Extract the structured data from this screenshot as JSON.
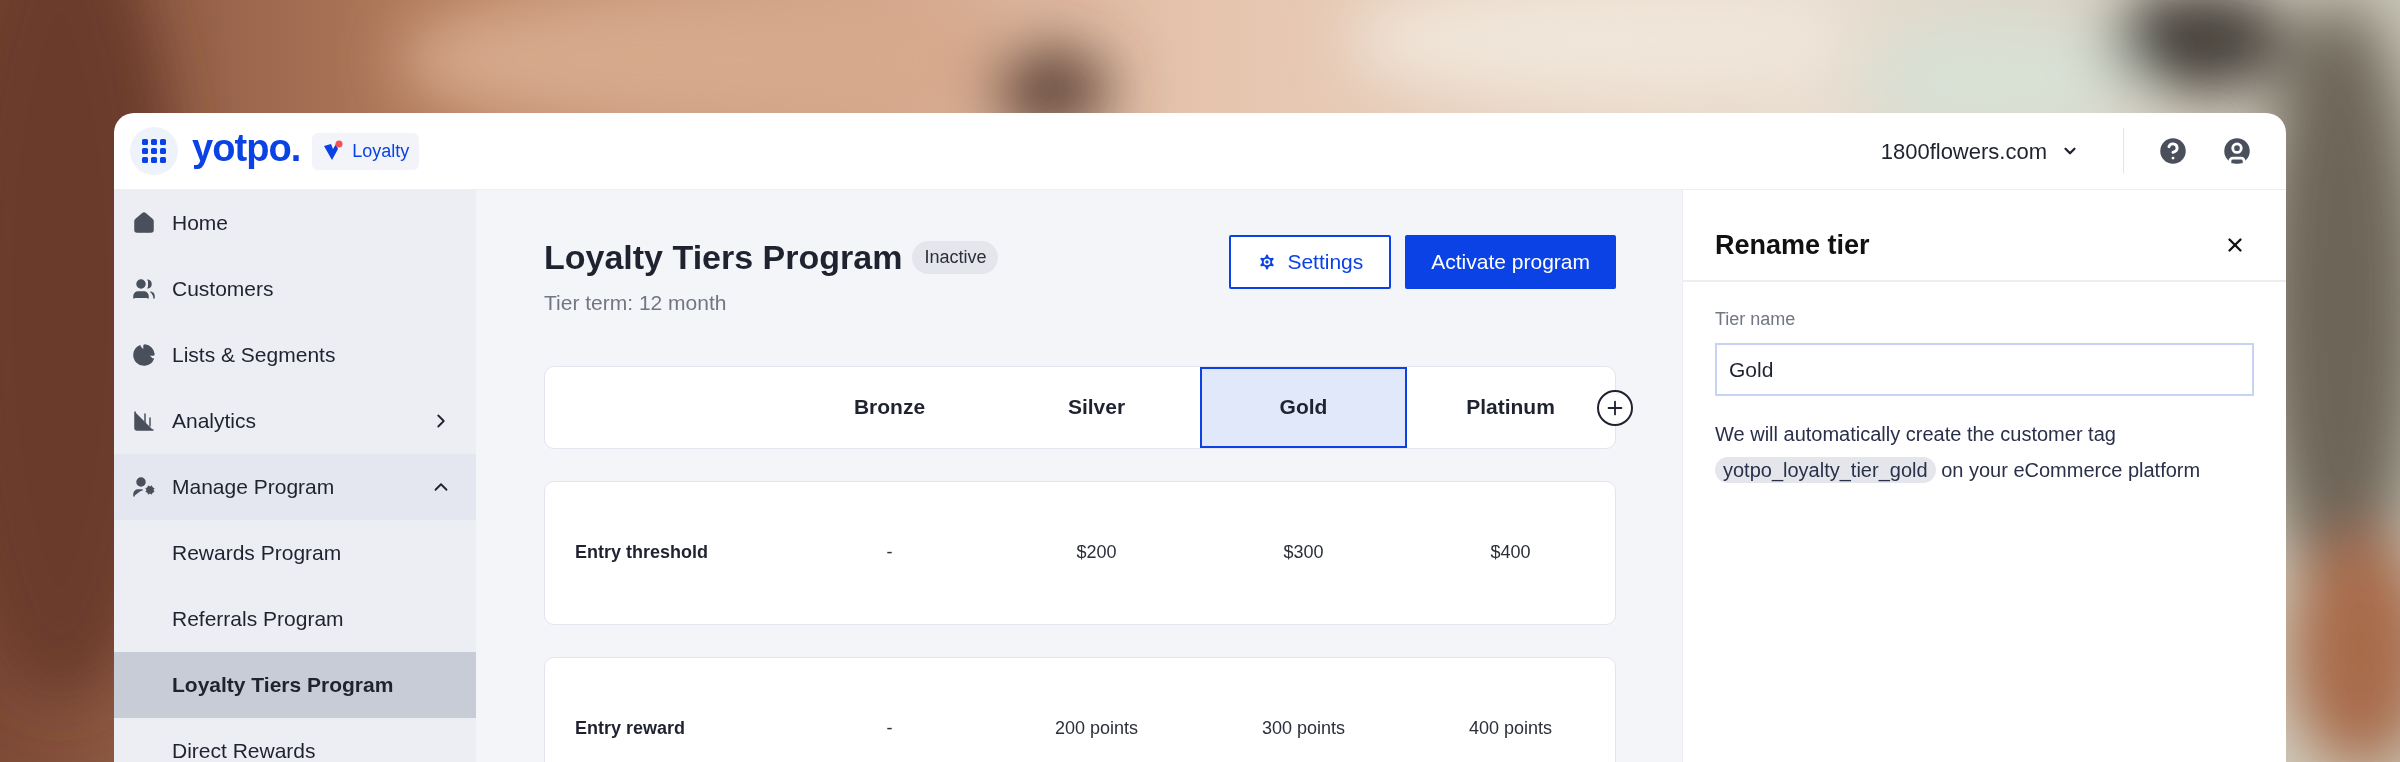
{
  "header": {
    "logo": "yotpo.",
    "product_badge": "Loyalty",
    "store": "1800flowers.com"
  },
  "sidebar": {
    "items": [
      {
        "label": "Home",
        "selected": false
      },
      {
        "label": "Customers",
        "selected": false
      },
      {
        "label": "Lists & Segments",
        "selected": false
      },
      {
        "label": "Analytics",
        "selected": false,
        "expanded": false
      },
      {
        "label": "Manage Program",
        "selected": false,
        "expanded": true,
        "children": [
          {
            "label": "Rewards Program",
            "selected": false
          },
          {
            "label": "Referrals Program",
            "selected": false
          },
          {
            "label": "Loyalty Tiers Program",
            "selected": true
          },
          {
            "label": "Direct Rewards",
            "selected": false
          }
        ]
      }
    ]
  },
  "page": {
    "title": "Loyalty Tiers Program",
    "status_badge": "Inactive",
    "subtitle": "Tier term: 12 month",
    "buttons": [
      {
        "kind": "outline",
        "label": "Settings"
      },
      {
        "kind": "primary",
        "label": "Activate program"
      }
    ],
    "tiers": [
      {
        "name": "Bronze",
        "selected": false
      },
      {
        "name": "Silver",
        "selected": false
      },
      {
        "name": "Gold",
        "selected": true
      },
      {
        "name": "Platinum",
        "selected": false
      }
    ],
    "rows": [
      {
        "label": "Entry threshold",
        "values": [
          "-",
          "$200",
          "$300",
          "$400"
        ]
      },
      {
        "label": "Entry reward",
        "values": [
          "-",
          "200 points",
          "300 points",
          "400 points"
        ]
      }
    ]
  },
  "panel": {
    "title": "Rename tier",
    "field_label": "Tier name",
    "field_value": "Gold",
    "note_before": "We will automatically create the customer tag",
    "tag": "yotpo_loyalty_tier_gold",
    "note_after": "on your eCommerce platform"
  }
}
